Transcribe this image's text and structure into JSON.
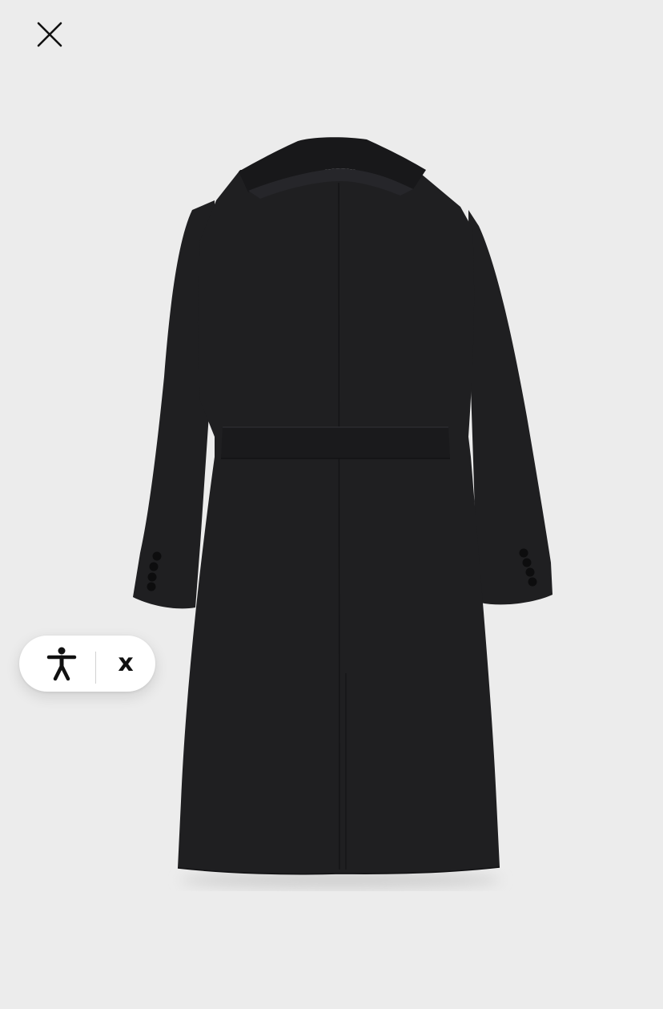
{
  "viewer": {
    "background": "#ececec",
    "close_icon": "close-icon"
  },
  "product": {
    "image_icon": "coat-back-view",
    "color": "#1f1f21"
  },
  "accessibility_widget": {
    "open_icon": "accessibility-person-icon",
    "close_label": "x"
  }
}
